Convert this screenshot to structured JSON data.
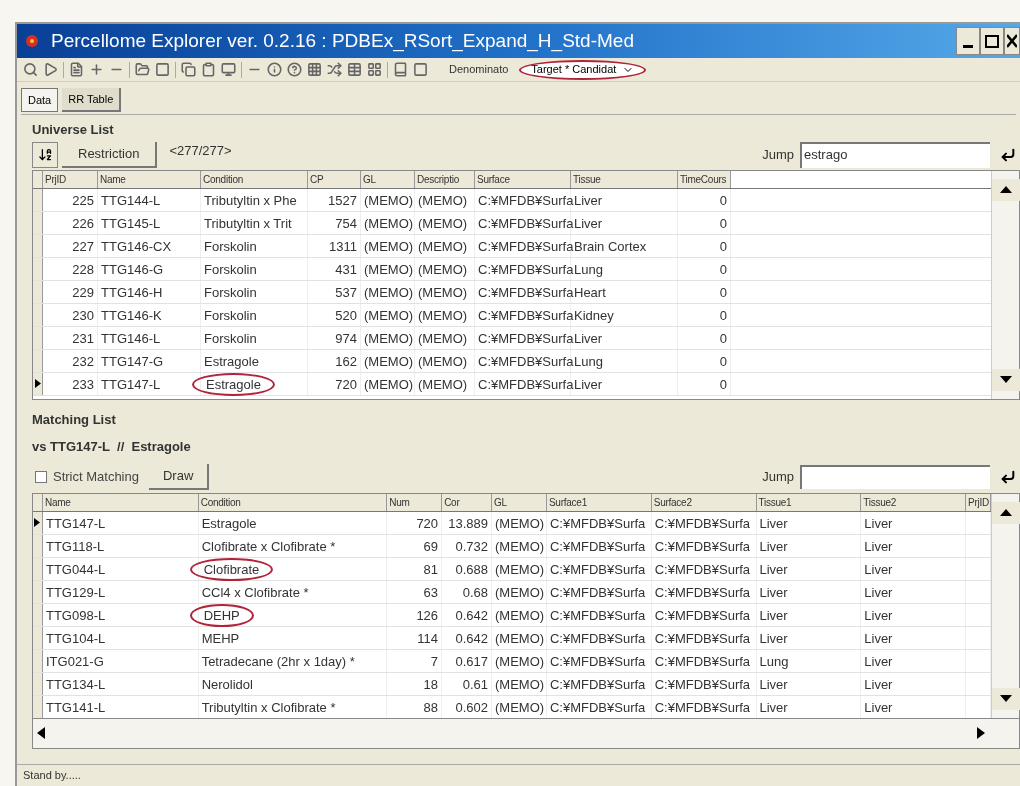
{
  "window": {
    "title": "Percellome Explorer ver. 0.2.16 : PDBEx_RSort_Expand_H_Std-Med"
  },
  "toolbar": {
    "denominator_label": "Denominato",
    "denominator": {
      "value": "Target * Candidat",
      "circled": true
    }
  },
  "tabs": [
    {
      "label": "Data",
      "selected": true
    },
    {
      "label": "RR Table",
      "selected": false
    }
  ],
  "universe": {
    "title": "Universe List",
    "restriction_button": "Restriction",
    "count": "<277/277>",
    "jump_label": "Jump",
    "jump_value": "estrago",
    "columns": [
      "PrjID",
      "Name",
      "Condition",
      "CP",
      "GL",
      "Descriptio",
      "Surface",
      "Tissue",
      "TimeCours"
    ],
    "rows": [
      {
        "cells": [
          "225",
          "TTG144-L",
          "Tributyltin x Phe",
          "1527",
          "(MEMO)",
          "(MEMO)",
          "C:¥MFDB¥Surfa",
          "Liver",
          "0"
        ],
        "selected": false,
        "circled": false
      },
      {
        "cells": [
          "226",
          "TTG145-L",
          "Tributyltin x Trit",
          "754",
          "(MEMO)",
          "(MEMO)",
          "C:¥MFDB¥Surfa",
          "Liver",
          "0"
        ],
        "selected": false,
        "circled": false
      },
      {
        "cells": [
          "227",
          "TTG146-CX",
          "Forskolin",
          "1311",
          "(MEMO)",
          "(MEMO)",
          "C:¥MFDB¥Surfa",
          "Brain Cortex",
          "0"
        ],
        "selected": false,
        "circled": false
      },
      {
        "cells": [
          "228",
          "TTG146-G",
          "Forskolin",
          "431",
          "(MEMO)",
          "(MEMO)",
          "C:¥MFDB¥Surfa",
          "Lung",
          "0"
        ],
        "selected": false,
        "circled": false
      },
      {
        "cells": [
          "229",
          "TTG146-H",
          "Forskolin",
          "537",
          "(MEMO)",
          "(MEMO)",
          "C:¥MFDB¥Surfa",
          "Heart",
          "0"
        ],
        "selected": false,
        "circled": false
      },
      {
        "cells": [
          "230",
          "TTG146-K",
          "Forskolin",
          "520",
          "(MEMO)",
          "(MEMO)",
          "C:¥MFDB¥Surfa",
          "Kidney",
          "0"
        ],
        "selected": false,
        "circled": false
      },
      {
        "cells": [
          "231",
          "TTG146-L",
          "Forskolin",
          "974",
          "(MEMO)",
          "(MEMO)",
          "C:¥MFDB¥Surfa",
          "Liver",
          "0"
        ],
        "selected": false,
        "circled": false
      },
      {
        "cells": [
          "232",
          "TTG147-G",
          "Estragole",
          "162",
          "(MEMO)",
          "(MEMO)",
          "C:¥MFDB¥Surfa",
          "Lung",
          "0"
        ],
        "selected": false,
        "circled": false
      },
      {
        "cells": [
          "233",
          "TTG147-L",
          "Estragole",
          "720",
          "(MEMO)",
          "(MEMO)",
          "C:¥MFDB¥Surfa",
          "Liver",
          "0"
        ],
        "selected": true,
        "circled": true
      }
    ]
  },
  "matching": {
    "title": "Matching List",
    "subtitle": "vs TTG147-L  //  Estragole",
    "strict_matching": {
      "label": "Strict Matching",
      "checked": false
    },
    "draw_button": "Draw",
    "jump_label": "Jump",
    "columns": [
      "Name",
      "Condition",
      "Num",
      "Cor",
      "GL",
      "Surface1",
      "Surface2",
      "Tissue1",
      "Tissue2",
      "PrjID"
    ],
    "rows": [
      {
        "cells": [
          "TTG147-L",
          "Estragole",
          "720",
          "13.889",
          "(MEMO)",
          "C:¥MFDB¥Surfa",
          "C:¥MFDB¥Surfa",
          "Liver",
          "Liver",
          ""
        ],
        "selected": true,
        "circled": false
      },
      {
        "cells": [
          "TTG118-L",
          "Clofibrate x Clofibrate *",
          "69",
          "0.732",
          "(MEMO)",
          "C:¥MFDB¥Surfa",
          "C:¥MFDB¥Surfa",
          "Liver",
          "Liver",
          ""
        ],
        "selected": false,
        "circled": false
      },
      {
        "cells": [
          "TTG044-L",
          "Clofibrate",
          "81",
          "0.688",
          "(MEMO)",
          "C:¥MFDB¥Surfa",
          "C:¥MFDB¥Surfa",
          "Liver",
          "Liver",
          ""
        ],
        "selected": false,
        "circled": true
      },
      {
        "cells": [
          "TTG129-L",
          "CCl4 x Clofibrate *",
          "63",
          "0.68",
          "(MEMO)",
          "C:¥MFDB¥Surfa",
          "C:¥MFDB¥Surfa",
          "Liver",
          "Liver",
          ""
        ],
        "selected": false,
        "circled": false
      },
      {
        "cells": [
          "TTG098-L",
          "DEHP",
          "126",
          "0.642",
          "(MEMO)",
          "C:¥MFDB¥Surfa",
          "C:¥MFDB¥Surfa",
          "Liver",
          "Liver",
          ""
        ],
        "selected": false,
        "circled": true
      },
      {
        "cells": [
          "TTG104-L",
          "MEHP",
          "114",
          "0.642",
          "(MEMO)",
          "C:¥MFDB¥Surfa",
          "C:¥MFDB¥Surfa",
          "Liver",
          "Liver",
          ""
        ],
        "selected": false,
        "circled": false
      },
      {
        "cells": [
          "ITG021-G",
          "Tetradecane (2hr x 1day) *",
          "7",
          "0.617",
          "(MEMO)",
          "C:¥MFDB¥Surfa",
          "C:¥MFDB¥Surfa",
          "Lung",
          "Liver",
          ""
        ],
        "selected": false,
        "circled": false
      },
      {
        "cells": [
          "TTG134-L",
          "Nerolidol",
          "18",
          "0.61",
          "(MEMO)",
          "C:¥MFDB¥Surfa",
          "C:¥MFDB¥Surfa",
          "Liver",
          "Liver",
          ""
        ],
        "selected": false,
        "circled": false
      },
      {
        "cells": [
          "TTG141-L",
          "Tributyltin x Clofibrate *",
          "88",
          "0.602",
          "(MEMO)",
          "C:¥MFDB¥Surfa",
          "C:¥MFDB¥Surfa",
          "Liver",
          "Liver",
          ""
        ],
        "selected": false,
        "circled": false
      }
    ]
  },
  "status_bar": "Stand by....."
}
